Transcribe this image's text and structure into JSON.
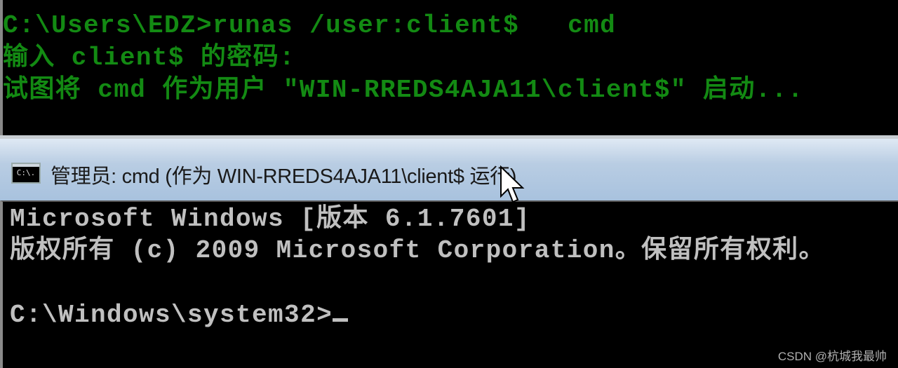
{
  "top_terminal": {
    "lines": [
      "C:\\Users\\EDZ>runas /user:client$   cmd",
      "输入 client$ 的密码:",
      "试图将 cmd 作为用户 \"WIN-RREDS4AJA11\\client$\" 启动..."
    ],
    "text_color": "#138a13"
  },
  "window": {
    "icon": "cmd-console-icon",
    "icon_text": "C:\\.",
    "title": "管理员: cmd (作为 WIN-RREDS4AJA11\\client$ 运行)"
  },
  "console": {
    "lines": [
      "Microsoft Windows [版本 6.1.7601]",
      "版权所有 (c) 2009 Microsoft Corporation。保留所有权利。",
      "",
      "C:\\Windows\\system32>"
    ],
    "text_color": "#c0c0c0"
  },
  "watermark": "CSDN @杭城我最帅"
}
